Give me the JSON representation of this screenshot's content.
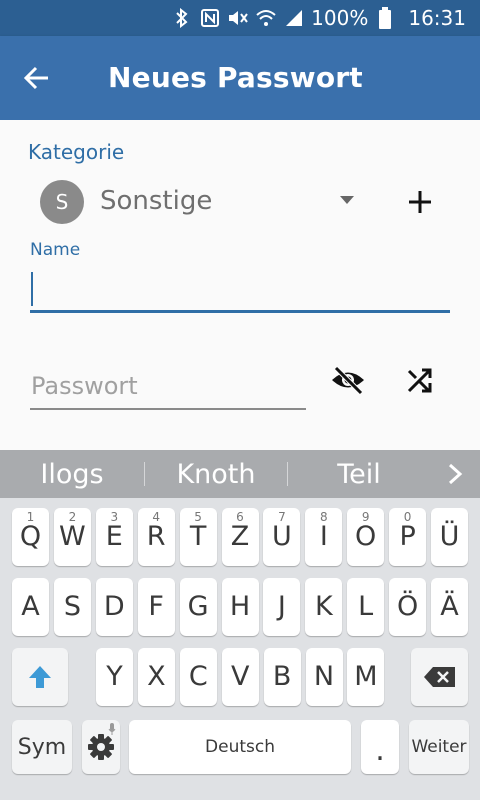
{
  "status_bar": {
    "battery": "100%",
    "time": "16:31",
    "icons": [
      "bluetooth-icon",
      "nfc-icon",
      "mute-icon",
      "wifi-icon",
      "signal-icon",
      "battery-icon"
    ]
  },
  "toolbar": {
    "title": "Neues Passwort",
    "back_icon": "arrow-left-icon"
  },
  "form": {
    "category_label": "Kategorie",
    "category_avatar": "S",
    "category_value": "Sonstige",
    "name_label": "Name",
    "name_value": "",
    "password_placeholder": "Passwort"
  },
  "suggestions": [
    "Ilogs",
    "Knoth",
    "Teil"
  ],
  "keyboard": {
    "row1": [
      {
        "ch": "Q",
        "num": "1"
      },
      {
        "ch": "W",
        "num": "2"
      },
      {
        "ch": "E",
        "num": "3"
      },
      {
        "ch": "R",
        "num": "4"
      },
      {
        "ch": "T",
        "num": "5"
      },
      {
        "ch": "Z",
        "num": "6"
      },
      {
        "ch": "U",
        "num": "7"
      },
      {
        "ch": "I",
        "num": "8"
      },
      {
        "ch": "O",
        "num": "9"
      },
      {
        "ch": "P",
        "num": "0"
      },
      {
        "ch": "Ü",
        "num": ""
      }
    ],
    "row2": [
      "A",
      "S",
      "D",
      "F",
      "G",
      "H",
      "J",
      "K",
      "L",
      "Ö",
      "Ä"
    ],
    "row3": [
      "Y",
      "X",
      "C",
      "V",
      "B",
      "N",
      "M"
    ],
    "sym_label": "Sym",
    "space_label": "Deutsch",
    "period_label": ".",
    "next_label": "Weiter"
  },
  "colors": {
    "status_bar": "#2c5f92",
    "toolbar": "#3a70ac",
    "accent": "#2f6ea6",
    "shift": "#3d9ad6"
  }
}
